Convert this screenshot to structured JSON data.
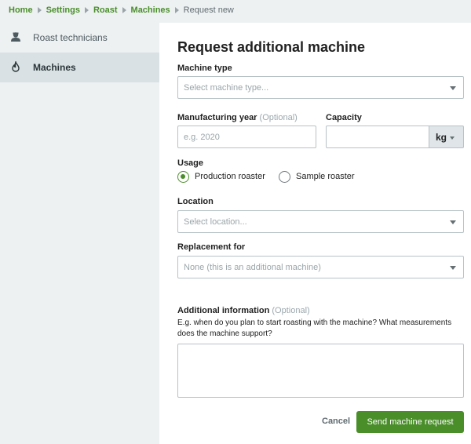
{
  "breadcrumb": {
    "items": [
      "Home",
      "Settings",
      "Roast",
      "Machines"
    ],
    "current": "Request new"
  },
  "sidebar": {
    "items": [
      {
        "label": "Roast technicians",
        "icon": "person-icon",
        "active": false
      },
      {
        "label": "Machines",
        "icon": "flame-icon",
        "active": true
      }
    ]
  },
  "form": {
    "title": "Request additional machine",
    "machine_type": {
      "label": "Machine type",
      "placeholder": "Select machine type..."
    },
    "manufacturing_year": {
      "label": "Manufacturing year",
      "optional": "(Optional)",
      "placeholder": "e.g. 2020"
    },
    "capacity": {
      "label": "Capacity",
      "value": "",
      "unit": "kg"
    },
    "usage": {
      "label": "Usage",
      "options": [
        "Production roaster",
        "Sample roaster"
      ],
      "selected": "Production roaster"
    },
    "location": {
      "label": "Location",
      "placeholder": "Select location..."
    },
    "replacement_for": {
      "label": "Replacement for",
      "value": "None (this is an additional machine)"
    },
    "additional_info": {
      "label": "Additional information",
      "optional": "(Optional)",
      "hint": "E.g. when do you plan to start roasting with the machine? What measurements does the machine support?",
      "value": ""
    },
    "cancel_label": "Cancel",
    "submit_label": "Send machine request"
  },
  "colors": {
    "accent": "#4a8e2a",
    "sidebar_bg": "#edf1f2",
    "sidebar_active_bg": "#d9e1e4",
    "border": "#b8c2c6"
  }
}
